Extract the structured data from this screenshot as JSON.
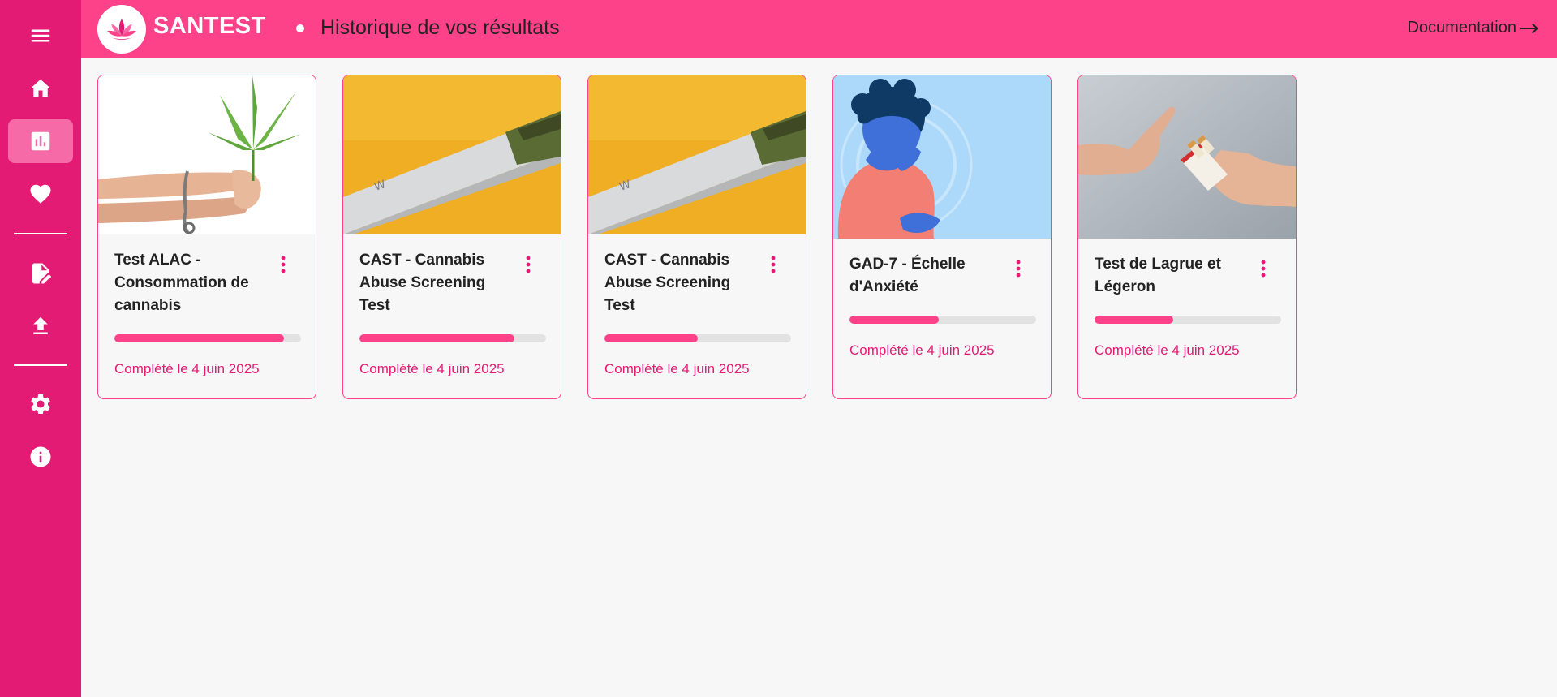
{
  "header": {
    "brand": "SANTEST",
    "title": "Historique de vos résultats",
    "doc_link": "Documentation"
  },
  "sidebar": {
    "items": [
      {
        "icon": "menu-icon"
      },
      {
        "icon": "home-icon"
      },
      {
        "icon": "chart-icon",
        "active": true
      },
      {
        "icon": "heart-icon"
      },
      {
        "icon": "edit-document-icon"
      },
      {
        "icon": "upload-icon"
      },
      {
        "icon": "gear-icon"
      },
      {
        "icon": "info-icon"
      }
    ]
  },
  "colors": {
    "sidebar": "#e31b74",
    "header": "#fe428a",
    "accent": "#fe428a",
    "active_item": "#f56aa7",
    "completed_text": "#e31b74"
  },
  "cards": [
    {
      "title": "Test ALAC - Consommation de cannabis",
      "progress": 0.91,
      "completed": "Complété le 4 juin 2025"
    },
    {
      "title": "CAST - Cannabis Abuse Screening Test",
      "progress": 0.83,
      "completed": "Complété le 4 juin 2025"
    },
    {
      "title": "CAST - Cannabis Abuse Screening Test",
      "progress": 0.5,
      "completed": "Complété le 4 juin 2025"
    },
    {
      "title": "GAD-7 - Échelle d'Anxiété",
      "progress": 0.48,
      "completed": "Complété le 4 juin 2025"
    },
    {
      "title": "Test de Lagrue et Légeron",
      "progress": 0.42,
      "completed": "Complété le 4 juin 2025"
    }
  ]
}
